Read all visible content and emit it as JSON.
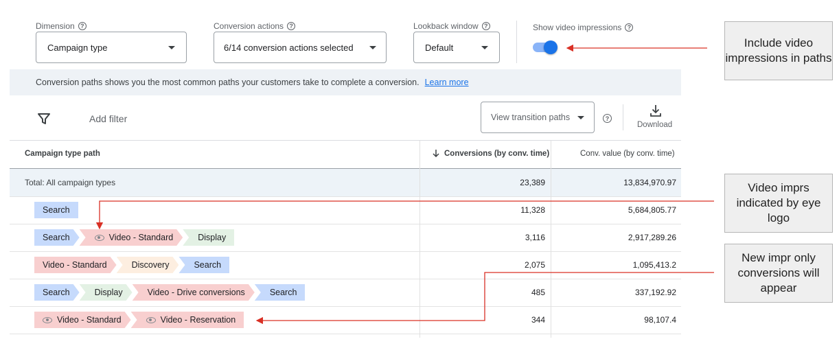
{
  "controls": {
    "dimension_label": "Dimension",
    "dimension_value": "Campaign type",
    "conversion_label": "Conversion actions",
    "conversion_value": "6/14 conversion actions selected",
    "lookback_label": "Lookback window",
    "lookback_value": "Default",
    "video_label": "Show video impressions",
    "video_toggle_on": true
  },
  "info": {
    "text": "Conversion paths shows you the most common paths your customers take to complete a conversion.",
    "link": "Learn more"
  },
  "toolbar": {
    "add_filter": "Add filter",
    "view_paths": "View transition paths",
    "download": "Download"
  },
  "table": {
    "headers": [
      "Campaign type path",
      "Conversions (by conv. time)",
      "Conv. value (by conv. time)"
    ],
    "total": {
      "label": "Total: All campaign types",
      "conversions": "23,389",
      "value": "13,834,970.97"
    },
    "rows": [
      {
        "conversions": "11,328",
        "value": "5,684,805.77",
        "path": [
          {
            "label": "Search",
            "type": "search",
            "eye": false
          }
        ]
      },
      {
        "conversions": "3,116",
        "value": "2,917,289.26",
        "path": [
          {
            "label": "Search",
            "type": "search",
            "eye": false
          },
          {
            "label": "Video - Standard",
            "type": "video",
            "eye": true
          },
          {
            "label": "Display",
            "type": "display",
            "eye": false
          }
        ]
      },
      {
        "conversions": "2,075",
        "value": "1,095,413.2",
        "path": [
          {
            "label": "Video - Standard",
            "type": "video",
            "eye": false
          },
          {
            "label": "Discovery",
            "type": "discovery",
            "eye": false
          },
          {
            "label": "Search",
            "type": "search",
            "eye": false
          }
        ]
      },
      {
        "conversions": "485",
        "value": "337,192.92",
        "path": [
          {
            "label": "Search",
            "type": "search",
            "eye": false
          },
          {
            "label": "Display",
            "type": "display",
            "eye": false
          },
          {
            "label": "Video - Drive conversions",
            "type": "video",
            "eye": false
          },
          {
            "label": "Search",
            "type": "search",
            "eye": false
          }
        ]
      },
      {
        "conversions": "344",
        "value": "98,107.4",
        "path": [
          {
            "label": "Video - Standard",
            "type": "video",
            "eye": true
          },
          {
            "label": "Video - Reservation",
            "type": "video",
            "eye": true
          }
        ]
      }
    ]
  },
  "callouts": {
    "c1": "Include video impressions in paths",
    "c2": "Video imprs indicated by eye logo",
    "c3": "New impr only conversions will appear"
  },
  "colors": {
    "accent": "#1a73e8",
    "arrow": "#d93025",
    "search_chip": "#c6dafc",
    "video_chip": "#f8cfcf",
    "display_chip": "#e3f1e4",
    "discovery_chip": "#fdeee0"
  }
}
